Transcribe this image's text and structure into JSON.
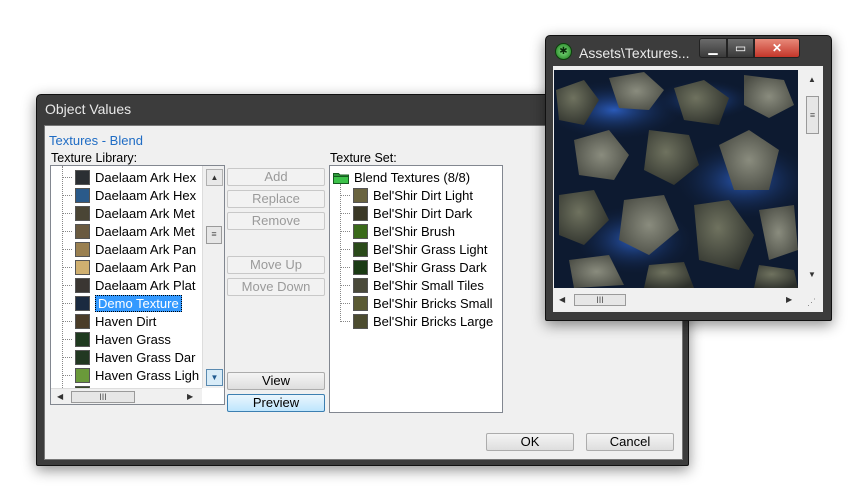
{
  "dialog": {
    "title": "Object Values",
    "section_title": "Textures - Blend",
    "library_label": "Texture Library:",
    "set_label": "Texture Set:",
    "library_items": [
      {
        "label": "Daelaam Ark Hex",
        "color": "#2b2f33",
        "selected": false
      },
      {
        "label": "Daelaam Ark Hex",
        "color": "#2a5a8a",
        "selected": false
      },
      {
        "label": "Daelaam Ark Met",
        "color": "#4a4535",
        "selected": false
      },
      {
        "label": "Daelaam Ark Met",
        "color": "#6a5a40",
        "selected": false
      },
      {
        "label": "Daelaam Ark Pan",
        "color": "#9a8050",
        "selected": false
      },
      {
        "label": "Daelaam Ark Pan",
        "color": "#d0b070",
        "selected": false
      },
      {
        "label": "Daelaam Ark Plat",
        "color": "#3a3632",
        "selected": false
      },
      {
        "label": "Demo Texture",
        "color": "#1a2a40",
        "selected": true
      },
      {
        "label": "Haven Dirt",
        "color": "#4a3c28",
        "selected": false
      },
      {
        "label": "Haven Grass",
        "color": "#1f3a1f",
        "selected": false
      },
      {
        "label": "Haven Grass Dar",
        "color": "#223822",
        "selected": false
      },
      {
        "label": "Haven Grass Ligh",
        "color": "#6a9a3a",
        "selected": false
      },
      {
        "label": "Haven Grass R",
        "color": "#3a4a2a",
        "selected": false
      }
    ],
    "buttons": {
      "add": "Add",
      "replace": "Replace",
      "remove": "Remove",
      "move_up": "Move Up",
      "move_down": "Move Down",
      "view": "View",
      "preview": "Preview",
      "ok": "OK",
      "cancel": "Cancel"
    },
    "set_root": "Blend Textures (8/8)",
    "set_items": [
      {
        "label": "Bel'Shir Dirt Light",
        "color": "#6a6440"
      },
      {
        "label": "Bel'Shir Dirt Dark",
        "color": "#3a3826"
      },
      {
        "label": "Bel'Shir Brush",
        "color": "#3a6a1a"
      },
      {
        "label": "Bel'Shir Grass Light",
        "color": "#2a4a1a"
      },
      {
        "label": "Bel'Shir Grass Dark",
        "color": "#1a3a14"
      },
      {
        "label": "Bel'Shir Small Tiles",
        "color": "#4a4a3a"
      },
      {
        "label": "Bel'Shir Bricks Small",
        "color": "#5a5a34"
      },
      {
        "label": "Bel'Shir Bricks Large",
        "color": "#4c4c30"
      }
    ]
  },
  "preview_window": {
    "title": "Assets\\Textures...",
    "icon": "app-icon"
  }
}
